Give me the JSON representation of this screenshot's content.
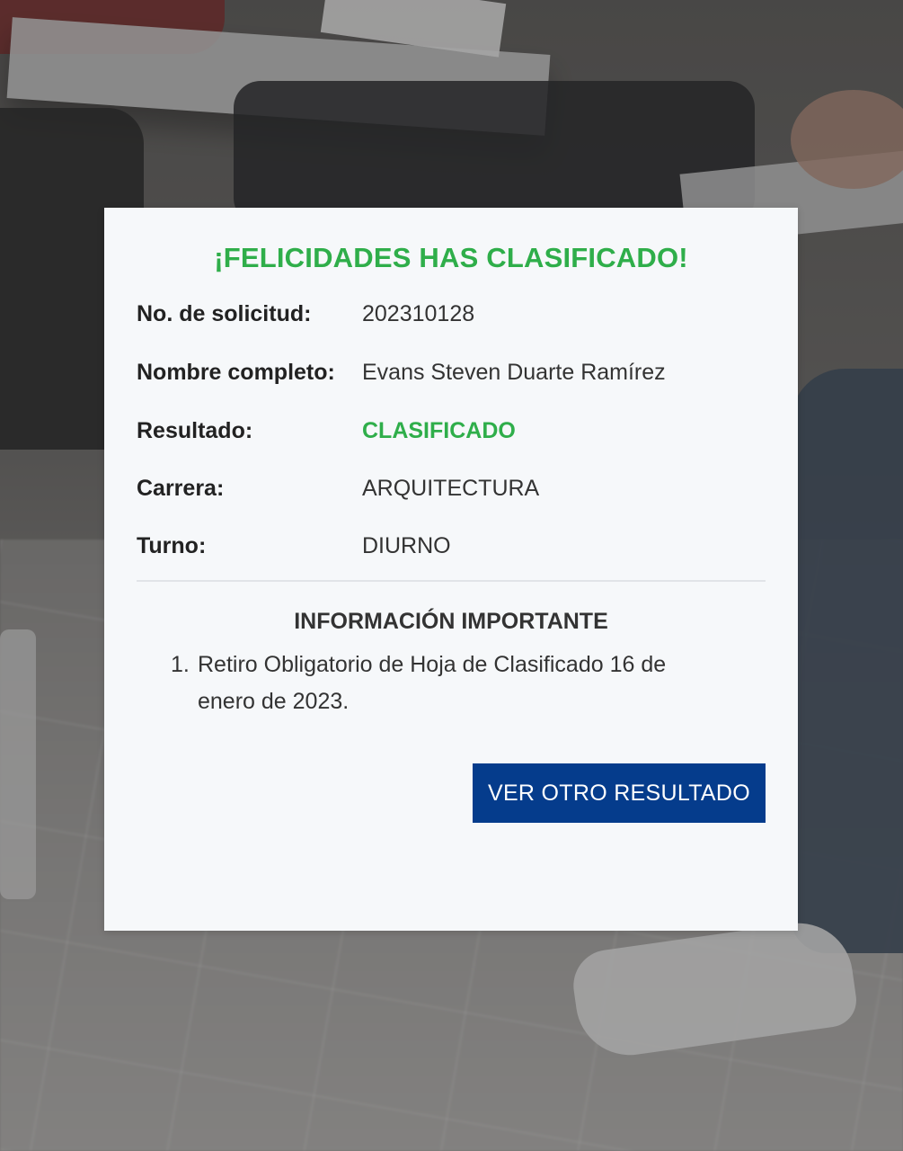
{
  "result": {
    "title": "¡FELICIDADES HAS CLASIFICADO!",
    "fields": [
      {
        "label": "No. de solicitud:",
        "value": "202310128"
      },
      {
        "label": "Nombre completo:",
        "value": "Evans Steven Duarte Ramírez"
      },
      {
        "label": "Resultado:",
        "value": "CLASIFICADO"
      },
      {
        "label": "Carrera:",
        "value": "ARQUITECTURA"
      },
      {
        "label": "Turno:",
        "value": "DIURNO"
      }
    ],
    "important": {
      "heading": "INFORMACIÓN IMPORTANTE",
      "items": [
        {
          "number": "1.",
          "text": "Retiro Obligatorio de Hoja de Clasificado 16 de enero de 2023."
        }
      ]
    },
    "button_label": "VER OTRO RESULTADO"
  },
  "colors": {
    "success": "#2fae4a",
    "primary_button": "#053c8c",
    "card_background": "#f6f8fa"
  }
}
